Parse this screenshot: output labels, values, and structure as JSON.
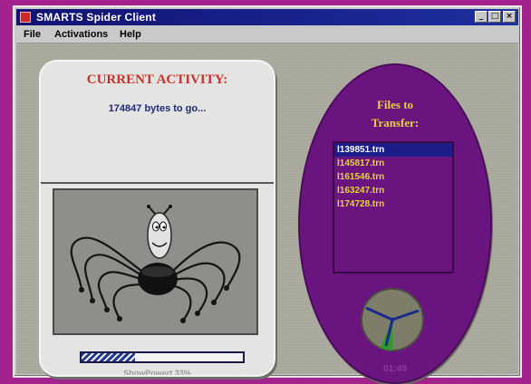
{
  "window": {
    "title": "SMARTS Spider Client",
    "buttons": {
      "minimize": "_",
      "maximize": "□",
      "close": "×"
    }
  },
  "menu": {
    "items": [
      "File",
      "Activations",
      "Help"
    ]
  },
  "activity": {
    "title": "CURRENT ACTIVITY:",
    "status": "174847 bytes to go...",
    "progress_label": "ShowPowert 33%",
    "progress_fraction": 0.33
  },
  "files": {
    "title_line1": "Files to",
    "title_line2": "Transfer:",
    "items": [
      "l139851.trn",
      "l145817.trn",
      "l161546.trn",
      "l163247.trn",
      "l174728.trn"
    ],
    "selected_index": 0
  },
  "clock": {
    "time": "01:49"
  },
  "colors": {
    "desktop": "#a3228d",
    "title_bar": "#121272",
    "activity_title": "#c8322c",
    "oval": "#6a1480",
    "file_text": "#e8d23c",
    "selection": "#1d1d8a"
  }
}
